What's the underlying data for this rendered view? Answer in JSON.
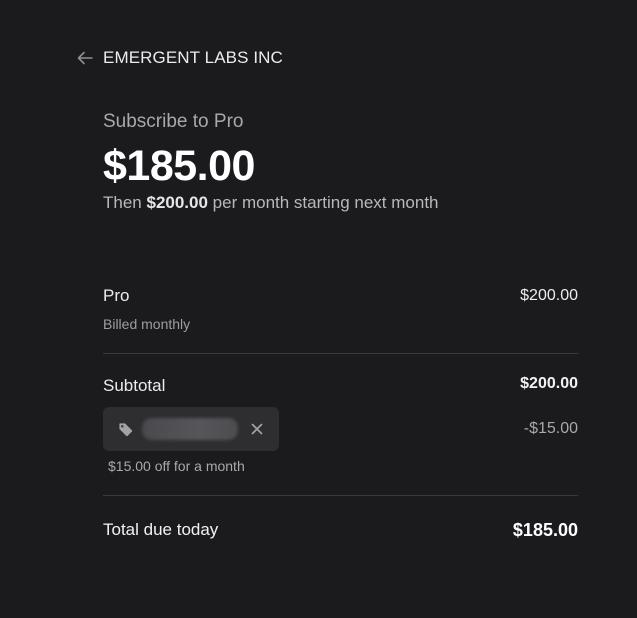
{
  "header": {
    "merchant_name": "EMERGENT LABS INC",
    "back_icon": "arrow-left-icon"
  },
  "summary": {
    "plan_line": "Subscribe to Pro",
    "price": "$185.00",
    "then_prefix": "Then ",
    "then_amount": "$200.00",
    "then_suffix": " per month starting next month"
  },
  "line_items": [
    {
      "name": "Pro",
      "billing": "Billed monthly",
      "amount": "$200.00"
    }
  ],
  "subtotal": {
    "label": "Subtotal",
    "amount": "$200.00"
  },
  "promo": {
    "tag_icon": "tag-icon",
    "code": "",
    "remove_icon": "close-icon",
    "discount_amount": "-$15.00",
    "note": "$15.00 off for a month"
  },
  "total": {
    "label": "Total due today",
    "amount": "$185.00"
  },
  "colors": {
    "background": "#1b1b1d",
    "text_primary": "#ececee",
    "text_secondary": "#a8a8ad",
    "chip_background": "#2e2e31",
    "divider": "#3a3a3e"
  }
}
